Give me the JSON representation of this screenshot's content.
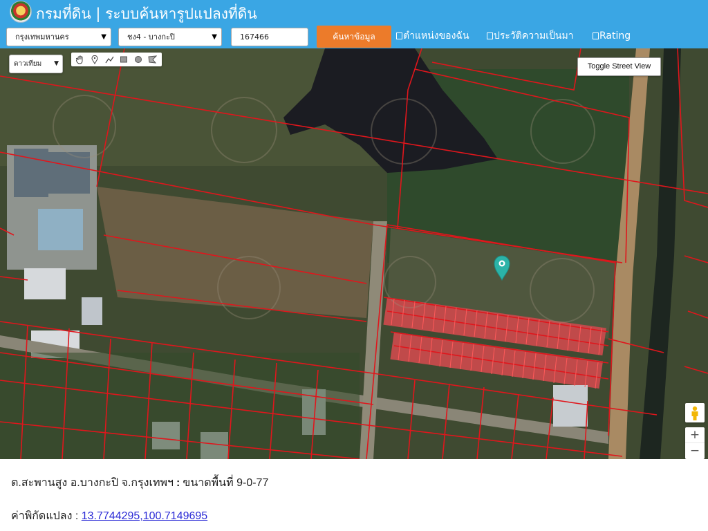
{
  "header": {
    "title": "กรมที่ดิน | ระบบค้นหารูปแปลงที่ดิน"
  },
  "search": {
    "province": "กรุงเทพมหานคร",
    "district": "ชง4 - บางกะปิ",
    "parcel_no": "167466",
    "search_label": "ค้นหาข้อมูล"
  },
  "options": {
    "my_location": "ตำแหน่งของฉัน",
    "history": "ประวัติความเป็นมา",
    "rating": "Rating"
  },
  "map": {
    "basemap": "ดาวเทียม",
    "street_view_label": "Toggle Street View",
    "zoom_in": "+",
    "zoom_out": "−",
    "tools": [
      "hand-icon",
      "marker-icon",
      "polyline-icon",
      "rectangle-icon",
      "circle-icon",
      "polygon-icon"
    ]
  },
  "info": {
    "location": "ต.สะพานสูง อ.บางกะปิ จ.กรุงเทพฯ",
    "separator": ":",
    "area": "ขนาดพื้นที่ 9-0-77",
    "coord_label": "ค่าพิกัดแปลง :",
    "coord_value": "13.7744295,100.7149695"
  },
  "colors": {
    "header": "#3aa6e4",
    "search_button": "#ec7b2a",
    "parcel_lines": "#e0161c",
    "pin": "#2bb3a8",
    "link": "#2b2bd6"
  }
}
